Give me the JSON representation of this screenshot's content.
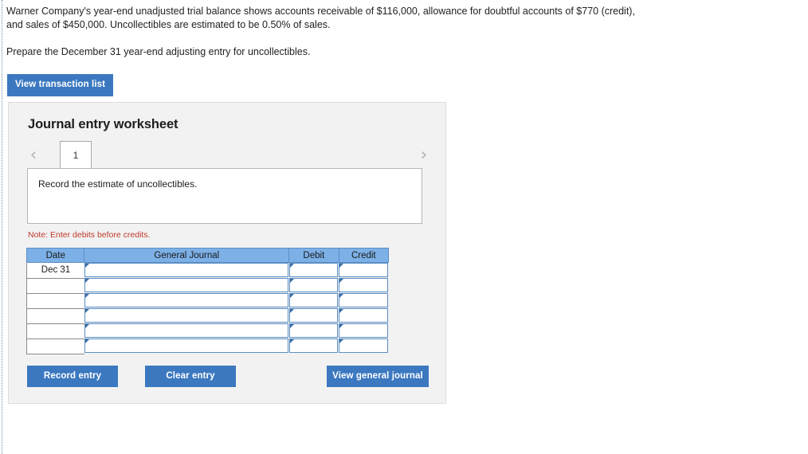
{
  "problem": {
    "paragraph1": "Warner Company's year-end unadjusted trial balance shows accounts receivable of $116,000, allowance for doubtful accounts of $770 (credit), and sales of $450,000. Uncollectibles are estimated to be 0.50% of sales.",
    "paragraph2": "Prepare the December 31 year-end adjusting entry for uncollectibles."
  },
  "toolbar": {
    "view_transaction_list_label": "View transaction list"
  },
  "worksheet": {
    "title": "Journal entry worksheet",
    "pager": {
      "prev_icon": "chevron-left-icon",
      "next_icon": "chevron-right-icon",
      "current_page": "1"
    },
    "instruction": "Record the estimate of uncollectibles.",
    "note": "Note: Enter debits before credits.",
    "table": {
      "headers": [
        "Date",
        "General Journal",
        "Debit",
        "Credit"
      ],
      "rows": [
        {
          "date": "Dec 31",
          "journal": "",
          "debit": "",
          "credit": ""
        },
        {
          "date": "",
          "journal": "",
          "debit": "",
          "credit": ""
        },
        {
          "date": "",
          "journal": "",
          "debit": "",
          "credit": ""
        },
        {
          "date": "",
          "journal": "",
          "debit": "",
          "credit": ""
        },
        {
          "date": "",
          "journal": "",
          "debit": "",
          "credit": ""
        },
        {
          "date": "",
          "journal": "",
          "debit": "",
          "credit": ""
        }
      ]
    },
    "buttons": {
      "record_entry": "Record entry",
      "clear_entry": "Clear entry",
      "view_general_journal": "View general journal"
    }
  },
  "colors": {
    "button_blue": "#3b78c0",
    "table_header_blue": "#7cb0e6",
    "cell_border_blue": "#5b8ec4",
    "note_red": "#c0392b",
    "panel_gray": "#f2f2f2"
  }
}
